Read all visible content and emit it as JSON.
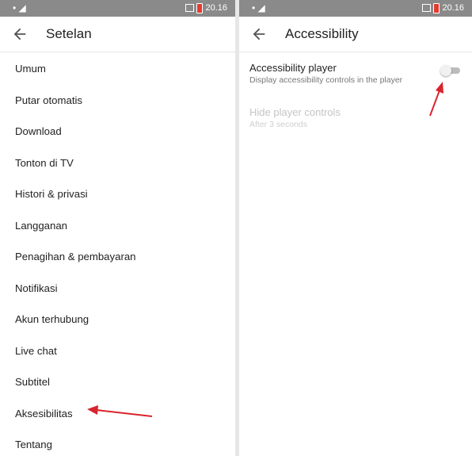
{
  "colors": {
    "status_bar": "#8a8a8a",
    "annotation_arrow": "#d9232d",
    "toggle_track": "#bcbcbc"
  },
  "left": {
    "status_time": "20.16",
    "title": "Setelan",
    "items": [
      {
        "label": "Umum"
      },
      {
        "label": "Putar otomatis"
      },
      {
        "label": "Download"
      },
      {
        "label": "Tonton di TV"
      },
      {
        "label": "Histori & privasi"
      },
      {
        "label": "Langganan"
      },
      {
        "label": "Penagihan & pembayaran"
      },
      {
        "label": "Notifikasi"
      },
      {
        "label": "Akun terhubung"
      },
      {
        "label": "Live chat"
      },
      {
        "label": "Subtitel"
      },
      {
        "label": "Aksesibilitas"
      },
      {
        "label": "Tentang"
      }
    ]
  },
  "right": {
    "status_time": "20.16",
    "title": "Accessibility",
    "settings": [
      {
        "title": "Accessibility player",
        "subtitle": "Display accessibility controls in the player",
        "enabled": true,
        "toggle": "off"
      },
      {
        "title": "Hide player controls",
        "subtitle": "After 3 seconds",
        "enabled": false
      }
    ]
  },
  "icons": {
    "back": "arrow-left-icon",
    "status_left": "sim-signal-icon",
    "battery": "battery-low-icon"
  }
}
